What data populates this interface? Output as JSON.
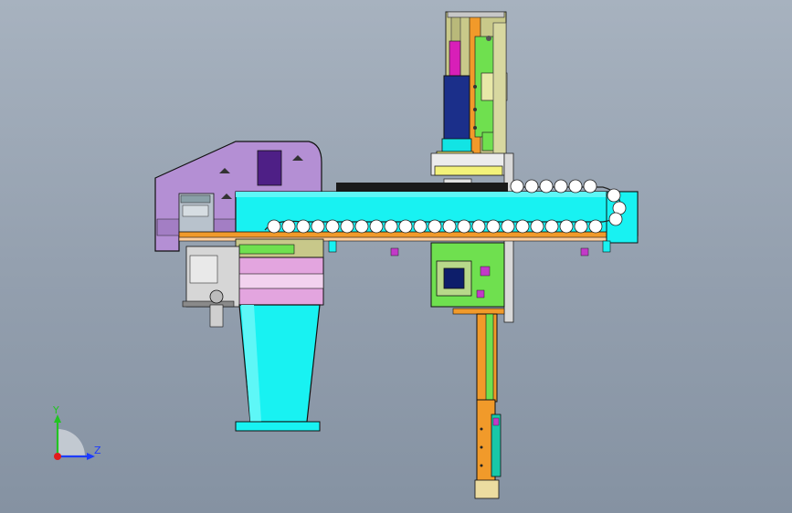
{
  "viewport": {
    "background_top": "#a7b2bf",
    "background_bottom": "#8592a2"
  },
  "colors": {
    "beam": "#18f2f2",
    "housing": "#b48fd4",
    "housing_dark": "#4e1f86",
    "orange": "#f19a2a",
    "green": "#67e04a",
    "olive": "#c8c87a",
    "pink": "#e3a5df",
    "outline": "#101010"
  },
  "triad": {
    "y_label": "Y",
    "z_label": "Z",
    "y_color": "#22c422",
    "z_color": "#1d3cff",
    "origin_color": "#e21b1b"
  },
  "icons": [
    "triad-icon"
  ]
}
